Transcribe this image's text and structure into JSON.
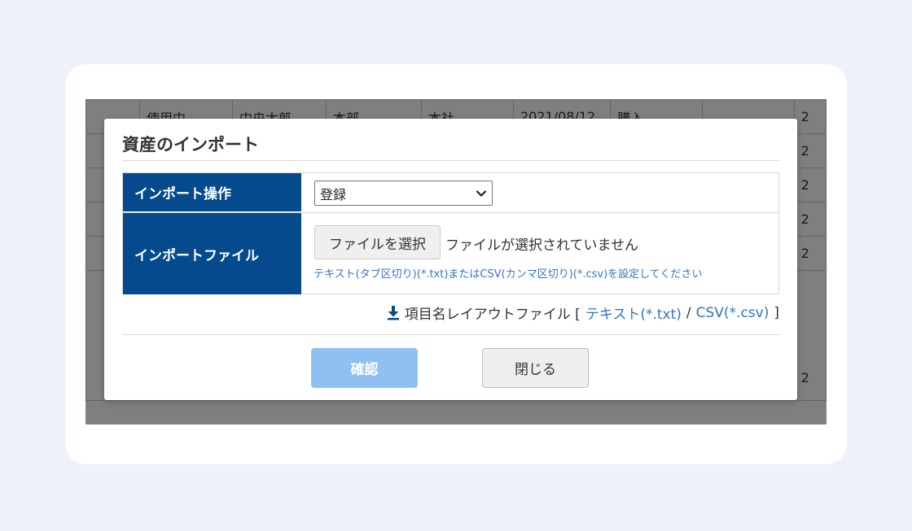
{
  "background_table": {
    "rows": [
      [
        "",
        "使用中",
        "中央太郎",
        "本部",
        "本社",
        "2021/08/12",
        "購入",
        "",
        "2"
      ],
      [
        "",
        "",
        "",
        "",
        "",
        "",
        "",
        "",
        "2"
      ],
      [
        "",
        "",
        "",
        "",
        "",
        "",
        "",
        "",
        "2"
      ],
      [
        "",
        "",
        "",
        "",
        "",
        "",
        "",
        "",
        "2"
      ],
      [
        "",
        "",
        "",
        "",
        "",
        "",
        "",
        "",
        "2"
      ],
      [
        "",
        "",
        "",
        "",
        "",
        "",
        "",
        "",
        "2"
      ]
    ]
  },
  "modal": {
    "title": "資産のインポート",
    "operation_label": "インポート操作",
    "operation_value": "登録",
    "file_label": "インポートファイル",
    "file_button": "ファイルを選択",
    "file_status": "ファイルが選択されていません",
    "hint": "テキスト(タブ区切り)(*.txt)またはCSV(カンマ区切り)(*.csv)を設定してください",
    "layout_text": "項目名レイアウトファイル [",
    "layout_txt_link": "テキスト(*.txt)",
    "layout_sep": "/",
    "layout_csv_link": "CSV(*.csv)",
    "layout_close": "]",
    "confirm_button": "確認",
    "close_button": "閉じる"
  },
  "colors": {
    "label_bg": "#044a8c",
    "confirm_bg": "#8ec1f1",
    "link": "#2f73c4"
  },
  "icons": {
    "download": "download-icon",
    "select_arrow": "chevron-down-icon"
  }
}
